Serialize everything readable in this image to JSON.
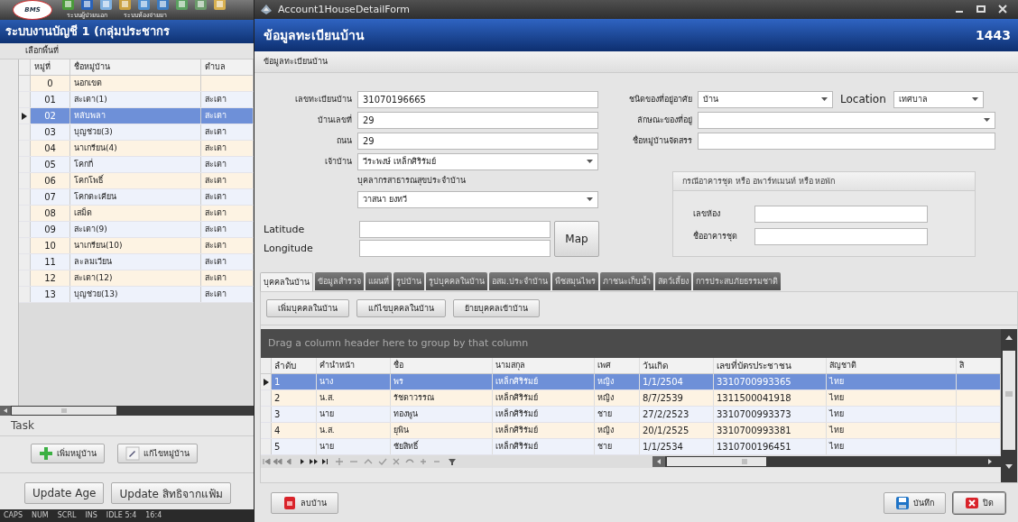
{
  "app": {
    "logo": "BMS",
    "menu": [
      "ระบบผู้ป่วยนอก",
      "ระบบห้องจ่ายยา"
    ],
    "title": "ระบบงานบัญชี 1 (กลุ่มประชากร",
    "area_label": "เลือกพื้นที่",
    "village_table": {
      "columns": [
        "หมู่ที่",
        "ชื่อหมู่บ้าน",
        "ตำบล"
      ],
      "rows": [
        {
          "cells": [
            "0",
            "นอกเขต"
          ],
          "selected": false
        },
        {
          "cells": [
            "01",
            "สะเตา(1)",
            "สะเตา"
          ],
          "selected": false
        },
        {
          "cells": [
            "02",
            "หลับพลา",
            "สะเตา"
          ],
          "selected": true
        },
        {
          "cells": [
            "03",
            "บุญช่วย(3)",
            "สะเตา"
          ],
          "selected": false
        },
        {
          "cells": [
            "04",
            "นาเกรียน(4)",
            "สะเตา"
          ],
          "selected": false
        },
        {
          "cells": [
            "05",
            "โคกกี่",
            "สะเตา"
          ],
          "selected": false
        },
        {
          "cells": [
            "06",
            "โคกโพธิ์",
            "สะเตา"
          ],
          "selected": false
        },
        {
          "cells": [
            "07",
            "โคกตะเคียน",
            "สะเตา"
          ],
          "selected": false
        },
        {
          "cells": [
            "08",
            "เสม็ด",
            "สะเตา"
          ],
          "selected": false
        },
        {
          "cells": [
            "09",
            "สะเตา(9)",
            "สะเตา"
          ],
          "selected": false
        },
        {
          "cells": [
            "10",
            "นาเกรียน(10)",
            "สะเตา"
          ],
          "selected": false
        },
        {
          "cells": [
            "11",
            "ละลมเวียน",
            "สะเตา"
          ],
          "selected": false
        },
        {
          "cells": [
            "12",
            "สะเตา(12)",
            "สะเตา"
          ],
          "selected": false
        },
        {
          "cells": [
            "13",
            "บุญช่วย(13)",
            "สะเตา"
          ],
          "selected": false
        }
      ]
    },
    "task": {
      "title": "Task",
      "buttons": [
        {
          "label": "เพิ่มหมู่บ้าน",
          "kind": "add"
        },
        {
          "label": "แก้ไขหมู่บ้าน",
          "kind": "edit"
        }
      ]
    },
    "update_buttons": [
      "Update Age",
      "Update สิทธิจากแฟ้ม"
    ],
    "status_bar": [
      "CAPS",
      "NUM",
      "SCRL",
      "INS",
      "IDLE 5:4",
      "16:4"
    ]
  },
  "dialog": {
    "window_title": "Account1HouseDetailForm",
    "header": "ข้อมูลทะเบียนบ้าน",
    "record_number": "1443",
    "section_tab": "ข้อมูลทะเบียนบ้าน",
    "form": {
      "left": [
        {
          "label": "เลขทะเบียนบ้าน",
          "value": "31070196665",
          "kind": "text"
        },
        {
          "label": "บ้านเลขที่",
          "value": "29",
          "kind": "text"
        },
        {
          "label": "ถนน",
          "value": "29",
          "kind": "text"
        },
        {
          "label": "เจ้าบ้าน",
          "value": "วีระพงษ์ เหล็กศิริรัมย์",
          "kind": "dropdown"
        }
      ],
      "health_staff": {
        "label": "บุคลากรสาธารณสุขประจำบ้าน",
        "value": "วาสนา ยงทวี",
        "kind": "dropdown"
      },
      "coords": [
        {
          "label": "Latitude"
        },
        {
          "label": "Longitude"
        }
      ],
      "map_button": "Map",
      "right": [
        {
          "label": "ชนิดของที่อยู่อาศัย",
          "value": "บ้าน",
          "kind": "dropdown"
        },
        {
          "label": "ลักษณะของที่อยู่",
          "kind": "dropdown"
        },
        {
          "label": "ชื่อหมู่บ้านจัดสรร",
          "kind": "text"
        }
      ],
      "location": {
        "label": "Location",
        "value": "เทศบาล",
        "kind": "dropdown"
      },
      "apartment_group": {
        "title": "กรณีอาคารชุด หรือ อพาร์ทเมนท์ หรือ หอพัก",
        "fields": [
          {
            "label": "เลขห้อง"
          },
          {
            "label": "ชื่ออาคารชุด"
          }
        ]
      }
    },
    "tabs": [
      {
        "label": "บุคคลในบ้าน",
        "selected": true
      },
      {
        "label": "ข้อมูลสำรวจ",
        "selected": false
      },
      {
        "label": "แผนที่",
        "selected": false
      },
      {
        "label": "รูปบ้าน",
        "selected": false
      },
      {
        "label": "รูปบุคคลในบ้าน",
        "selected": false
      },
      {
        "label": "อสม.ประจำบ้าน",
        "selected": false
      },
      {
        "label": "พืชสมุนไพร",
        "selected": false
      },
      {
        "label": "ภาชนะเก็บน้ำ",
        "selected": false
      },
      {
        "label": "สัตว์เลี้ยง",
        "selected": false
      },
      {
        "label": "การประสบภัยธรรมชาติ",
        "selected": false
      }
    ],
    "person_buttons": [
      "เพิ่มบุคคลในบ้าน",
      "แก้ไขบุคคลในบ้าน",
      "ย้ายบุคคลเข้าบ้าน"
    ],
    "group_hint": "Drag a column header here to group by that column",
    "person_table": {
      "columns": [
        "ลำดับ",
        "คำนำหน้า",
        "ชื่อ",
        "นามสกุล",
        "เพศ",
        "วันเกิด",
        "เลขที่บัตรประชาชน",
        "สัญชาติ",
        "สิ"
      ],
      "rows": [
        {
          "cells": [
            "1",
            "นาง",
            "พร",
            "เหล็กศิริรัมย์",
            "หญิง",
            "1/1/2504",
            "3310700993365",
            "ไทย"
          ],
          "selected": true
        },
        {
          "cells": [
            "2",
            "น.ส.",
            "รัชดาวรรณ",
            "เหล็กศิริรัมย์",
            "หญิง",
            "8/7/2539",
            "1311500041918",
            "ไทย"
          ],
          "selected": false
        },
        {
          "cells": [
            "3",
            "นาย",
            "ทองพูน",
            "เหล็กศิริรัมย์",
            "ชาย",
            "27/2/2523",
            "3310700993373",
            "ไทย"
          ],
          "selected": false
        },
        {
          "cells": [
            "4",
            "น.ส.",
            "ยุพิน",
            "เหล็กศิริรัมย์",
            "หญิง",
            "20/1/2525",
            "3310700993381",
            "ไทย"
          ],
          "selected": false
        },
        {
          "cells": [
            "5",
            "นาย",
            "ชัยสิทธิ์",
            "เหล็กศิริรัมย์",
            "ชาย",
            "1/1/2534",
            "1310700196451",
            "ไทย"
          ],
          "selected": false
        }
      ]
    },
    "footer_buttons": [
      {
        "label": "ลบบ้าน",
        "kind": "delete"
      },
      {
        "label": "บันทึก",
        "kind": "save"
      },
      {
        "label": "ปิด",
        "kind": "close"
      }
    ]
  }
}
